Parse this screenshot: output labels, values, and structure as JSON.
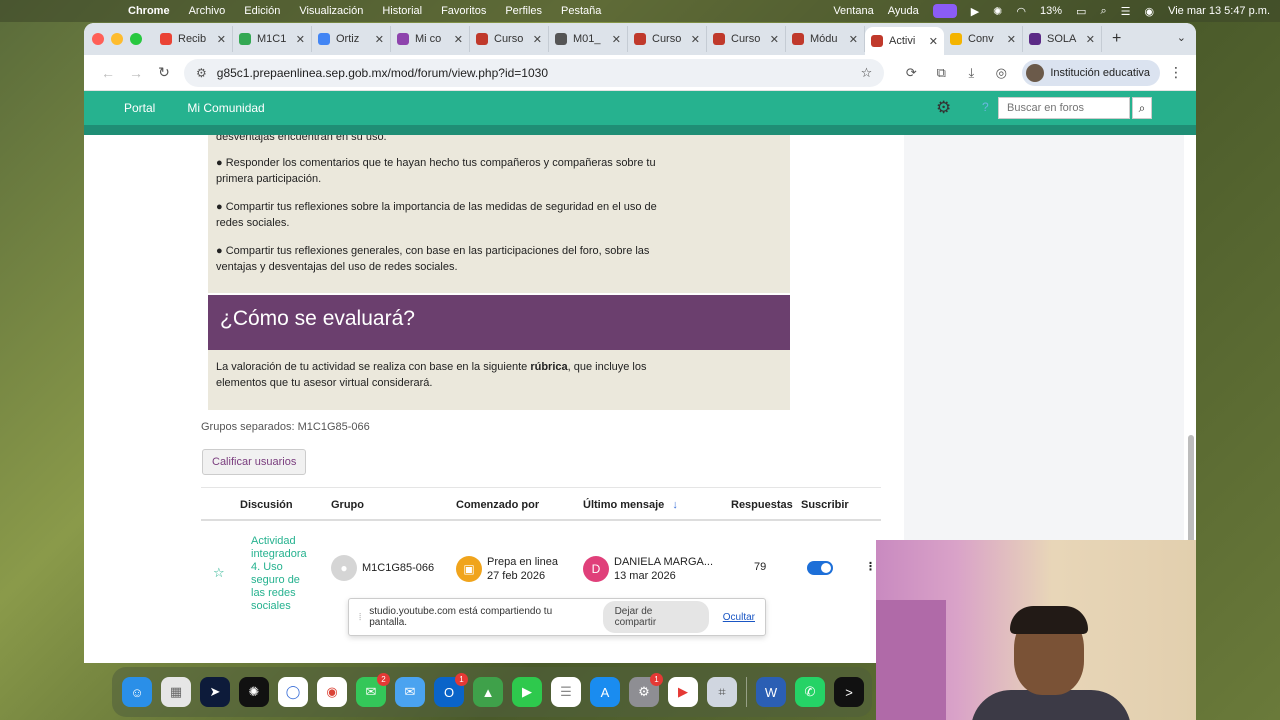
{
  "menubar": {
    "app": "Chrome",
    "items": [
      "Archivo",
      "Edición",
      "Visualización",
      "Historial",
      "Favoritos",
      "Perfiles",
      "Pestaña"
    ],
    "right_items": [
      "Ventana",
      "Ayuda"
    ],
    "battery": "13%",
    "clock": "Vie mar 13  5:47 p.m."
  },
  "tabs": [
    {
      "label": "Recib",
      "color": "#ea4335"
    },
    {
      "label": "M1C1",
      "color": "#34a853"
    },
    {
      "label": "Ortiz",
      "color": "#4285f4"
    },
    {
      "label": "Mi co",
      "color": "#8e44ad"
    },
    {
      "label": "Curso",
      "color": "#c0392b"
    },
    {
      "label": "M01_",
      "color": "#555555"
    },
    {
      "label": "Curso",
      "color": "#c0392b"
    },
    {
      "label": "Curso",
      "color": "#c0392b"
    },
    {
      "label": "Módu",
      "color": "#c0392b"
    },
    {
      "label": "Activi",
      "color": "#c0392b",
      "active": true
    },
    {
      "label": "Conv",
      "color": "#f4b400"
    },
    {
      "label": "SOLA",
      "color": "#5b2a86"
    }
  ],
  "address": {
    "url": "g85c1.prepaenlinea.sep.gob.mx/mod/forum/view.php?id=1030",
    "profile_label": "Institución educativa"
  },
  "site": {
    "nav": [
      "Portal",
      "Mi Comunidad"
    ],
    "search_placeholder": "Buscar en foros"
  },
  "instructions": {
    "fragment": "desventajas encuentran en su uso.",
    "bullets": [
      "● Responder los comentarios que te hayan hecho tus compañeros y compañeras sobre tu primera participación.",
      "● Compartir tus reflexiones sobre la importancia de las medidas de seguridad en el uso de redes sociales.",
      "● Compartir tus reflexiones generales, con base en las participaciones del foro, sobre las ventajas y desventajas del uso de redes sociales."
    ]
  },
  "evaluation": {
    "heading": "¿Cómo se evaluará?",
    "text_before": "La valoración de tu actividad se realiza con base en la siguiente ",
    "text_bold": "rúbrica",
    "text_after": ", que incluye los elementos que tu asesor virtual considerará."
  },
  "forum": {
    "groups_label": "Grupos separados: M1C1G85-066",
    "grade_button": "Calificar usuarios",
    "columns": {
      "discussion": "Discusión",
      "group": "Grupo",
      "started_by": "Comenzado por",
      "last_post": "Último mensaje",
      "replies": "Respuestas",
      "subscribe": "Suscribir"
    },
    "row": {
      "title": "Actividad integradora 4. Uso seguro de las redes sociales",
      "group": "M1C1G85-066",
      "started_by_name": "Prepa en linea",
      "started_by_date": "27 feb 2026",
      "last_initial": "D",
      "last_name": "DANIELA MARGA...",
      "last_date": "13 mar 2026",
      "replies": "79",
      "subscribed": true
    }
  },
  "sharing": {
    "message": "studio.youtube.com está compartiendo tu pantalla.",
    "stop": "Dejar de compartir",
    "hide": "Ocultar"
  },
  "dock": {
    "badges": {
      "messages": "2",
      "outlook": "1",
      "settings": "1"
    }
  },
  "colors": {
    "site_green": "#26b28f",
    "purple_heading": "#6b3f6e",
    "info_bg": "#ebe8dc"
  }
}
